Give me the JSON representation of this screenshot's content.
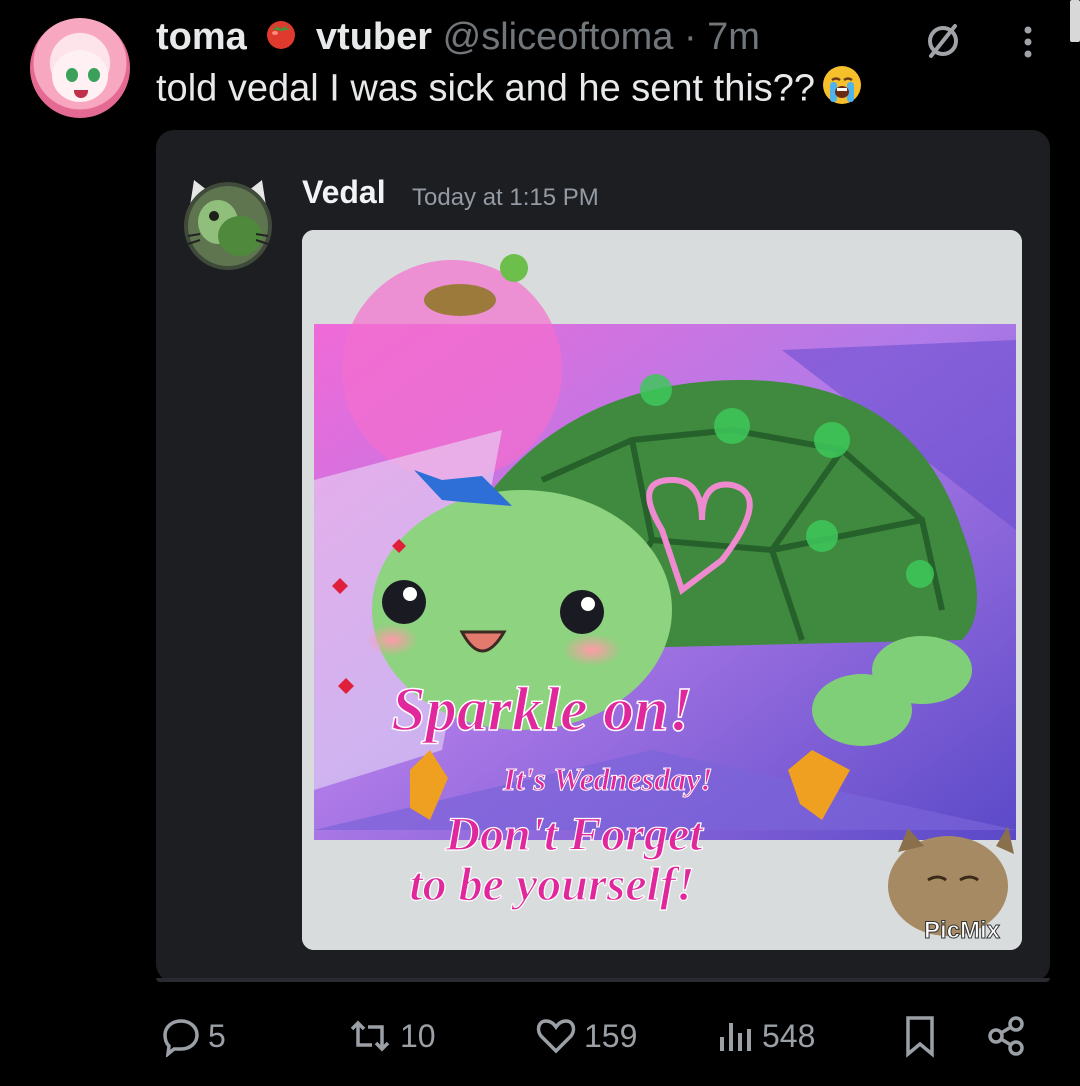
{
  "post": {
    "author_name": "toma",
    "author_tag": "vtuber",
    "handle": "@sliceoftoma",
    "separator": "·",
    "time": "7m",
    "text": "told vedal I was sick and he sent this??",
    "emoji_icon": "crying-face-emoji"
  },
  "embed": {
    "username": "Vedal",
    "timestamp": "Today at 1:15 PM",
    "image": {
      "text_line1": "Sparkle on!",
      "text_line2": "It's Wednesday!",
      "text_line3": "Don't Forget",
      "text_line4": "to be yourself!",
      "watermark": "PicMix"
    }
  },
  "actions": {
    "replies": "5",
    "reposts": "10",
    "likes": "159",
    "views": "548"
  },
  "colors": {
    "background": "#000000",
    "text": "#e7e9ea",
    "muted": "#71767b",
    "card": "#1d1e22",
    "accent_pink": "#e0289c"
  }
}
